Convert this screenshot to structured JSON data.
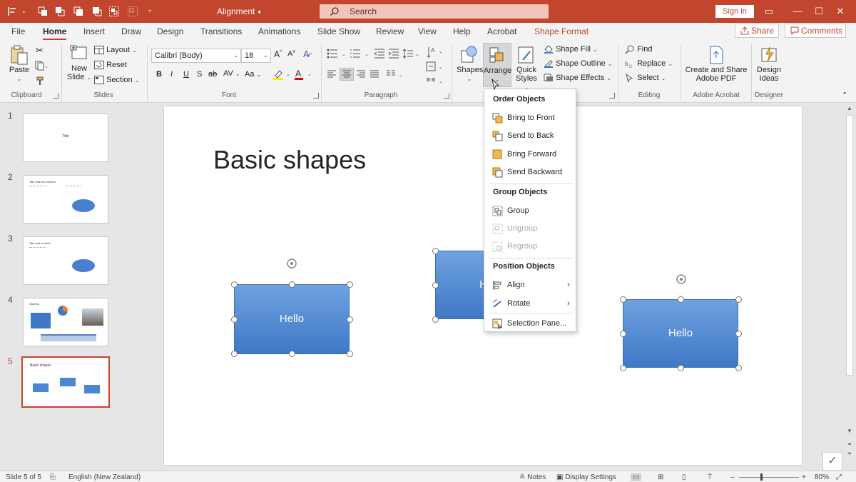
{
  "window": {
    "doc_title": "Alignment",
    "search_label": "Search",
    "signin_label": "Sign in"
  },
  "tabs": [
    "File",
    "Home",
    "Insert",
    "Draw",
    "Design",
    "Transitions",
    "Animations",
    "Slide Show",
    "Review",
    "View",
    "Help",
    "Acrobat",
    "Shape Format"
  ],
  "active_tab": "Home",
  "share_label": "Share",
  "comments_label": "Comments",
  "ribbon": {
    "clipboard": {
      "paste": "Paste",
      "group": "Clipboard"
    },
    "slides": {
      "new_slide_1": "New",
      "new_slide_2": "Slide",
      "layout": "Layout",
      "reset": "Reset",
      "section": "Section",
      "group": "Slides"
    },
    "font": {
      "font_name": "Calibri (Body)",
      "font_size": "18",
      "group": "Font",
      "bold": "B",
      "italic": "I",
      "underline": "U",
      "shadow": "S",
      "strike": "ab",
      "spacing": "AV",
      "case": "Aa"
    },
    "paragraph": {
      "group": "Paragraph"
    },
    "drawing": {
      "shapes": "Shapes",
      "arrange": "Arrange",
      "quick_styles_1": "Quick",
      "quick_styles_2": "Styles",
      "shape_fill": "Shape Fill",
      "shape_outline": "Shape Outline",
      "shape_effects": "Shape Effects"
    },
    "editing": {
      "find": "Find",
      "replace": "Replace",
      "select": "Select",
      "group": "Editing"
    },
    "acrobat": {
      "line1": "Create and Share",
      "line2": "Adobe PDF",
      "group": "Adobe Acrobat"
    },
    "designer": {
      "line1": "Design",
      "line2": "Ideas",
      "group": "Designer"
    }
  },
  "thumbnails": [
    {
      "num": "1",
      "title": "Title"
    },
    {
      "num": "2",
      "title": "Title and two content"
    },
    {
      "num": "3",
      "title": "Title and content"
    },
    {
      "num": "4",
      "title": "Objects"
    },
    {
      "num": "5",
      "title": "Basic shapes"
    }
  ],
  "slide": {
    "title": "Basic shapes",
    "shape1_text": "Hello",
    "shape2_text": "H",
    "shape3_text": "Hello"
  },
  "arrange_menu": {
    "order_header": "Order Objects",
    "bring_to_front": "Bring to Front",
    "send_to_back": "Send to Back",
    "bring_forward": "Bring Forward",
    "send_backward": "Send Backward",
    "group_header": "Group Objects",
    "group": "Group",
    "ungroup": "Ungroup",
    "regroup": "Regroup",
    "position_header": "Position Objects",
    "align": "Align",
    "rotate": "Rotate",
    "selection_pane": "Selection Pane..."
  },
  "status": {
    "slide_count": "Slide 5 of 5",
    "language": "English (New Zealand)",
    "notes": "Notes",
    "display_settings": "Display Settings",
    "zoom": "80%"
  },
  "colors": {
    "accent": "#c2452d",
    "shape_fill": "#4a86d4"
  }
}
